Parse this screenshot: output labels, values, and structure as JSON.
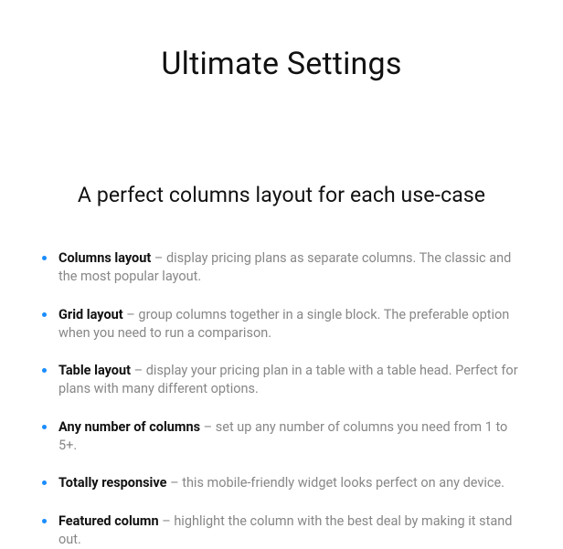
{
  "title": "Ultimate Settings",
  "subtitle": "A perfect columns layout for each use-case",
  "features": [
    {
      "name": "Columns layout",
      "desc": "display pricing plans as separate columns. The classic and the most popular layout."
    },
    {
      "name": "Grid layout",
      "desc": "group columns together in a single block. The preferable option when you need to run a comparison."
    },
    {
      "name": "Table layout",
      "desc": "display your pricing plan in a table with a table head. Perfect for plans with many different options."
    },
    {
      "name": "Any number of columns",
      "desc": "set up any number of columns you need from 1 to 5+."
    },
    {
      "name": "Totally responsive",
      "desc": "this mobile-friendly widget looks perfect on any device."
    },
    {
      "name": "Featured column",
      "desc": "highlight the column with the best deal by making it stand out."
    }
  ],
  "separator": " – "
}
